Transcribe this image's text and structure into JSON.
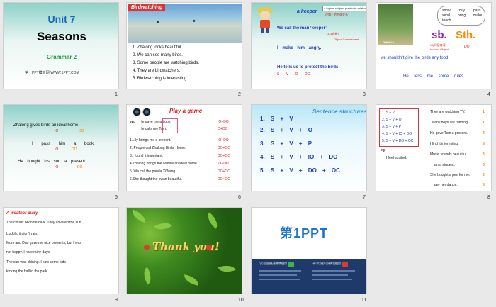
{
  "slides": [
    {
      "num": "1",
      "title": "Unit 7",
      "subtitle": "Seasons",
      "section": "Grammar 2",
      "footer": "第一PPT模板网-WWW.1PPT.COM"
    },
    {
      "num": "2",
      "banner": "Birdwatching",
      "lines": [
        "1. Zhalong looks beautiful.",
        "2. We can see many birds.",
        "3. Some people are watching birds.",
        "4. They are birdwatchers.",
        "5. Birdwatching is interesting."
      ]
    },
    {
      "num": "3",
      "heading": "a keeper",
      "note1": "A logical subject-predicate relation",
      "note2": "逻辑上的主谓关系",
      "line1": "We call the man ‘keeper’.",
      "line2": "I make him angry.",
      "line3": "He tells us to protect the birds",
      "oc_note": "OC(宾补)",
      "oc_note2": "Object Complement",
      "tags1": "S V O",
      "tags2": "S V O OC",
      "tags3": "S V O OC"
    },
    {
      "num": "4",
      "bubble": [
        "show",
        "send",
        "buy",
        "pass",
        "teach",
        "bring",
        "make"
      ],
      "big1": "sb.",
      "big2": "Sth.",
      "label1": "IO(间接宾语)",
      "label1b": "Indirect Object",
      "do_label": "DO",
      "label2": "XINHUA",
      "line1": "we shouldn’t give the birds any food.",
      "line2": "He tells me some rules."
    },
    {
      "num": "5",
      "lines": [
        "Zhalong gives birds an ideal home",
        "I pass him a book.",
        "He bought his son a present."
      ],
      "tags": [
        "IO",
        "DO"
      ]
    },
    {
      "num": "6",
      "banner": "Play a game",
      "eg": "eg:",
      "eg1": "He gave me a book.",
      "eg2": "He calls me Tom.",
      "eg1tag": "IO+DO",
      "eg2tag": "O+OC",
      "items": [
        {
          "text": "1.Lily brings me a present.",
          "tag": "IO+DO"
        },
        {
          "text": "2. People call Zhalong Birds’ Home.",
          "tag": "DO+OC"
        },
        {
          "text": "3.I found it important.",
          "tag": "DO+OC"
        },
        {
          "text": "4.Zhalong brings the wildlife an ideal home.",
          "tag": "IO+DO"
        },
        {
          "text": "5. We call the panda XiWang.",
          "tag": "DO+OC"
        },
        {
          "text": "6.She thought the swan beautiful.",
          "tag": "DO+OC"
        }
      ]
    },
    {
      "num": "7",
      "banner": "Sentence structures",
      "rows": [
        "1. S + V",
        "2. S + V + O",
        "3. S + V + P",
        "4. S + V + IO + DO",
        "5. S + V + DO + OC"
      ]
    },
    {
      "num": "8",
      "box": [
        "1. S + V",
        "2. S + V + O",
        "3. S + V + P",
        "4. S + V + IO + DO",
        "5. S + V + DO + OC"
      ],
      "eg": "eg:",
      "eg_line": "I feel excited.",
      "right": [
        "They are watching TV.",
        "Many boys are running.",
        "He gave Tom a present.",
        "I find it interesting.",
        "Music sounds beautiful.",
        "I am a student.",
        "She bought a pen for me.",
        "I saw her dance."
      ],
      "nums": [
        "1",
        "1",
        "4",
        "5",
        "3",
        "3",
        "2",
        "5"
      ]
    },
    {
      "num": "9",
      "title": "A weather diary",
      "lines": [
        "The clouds become dark. They covered the sun.",
        "Luckily, it didn’t rain.",
        "Mum and Dad gave me nice presents, but I was",
        "not happy. I hate rainy days.",
        "The sun was shining. I saw some kids",
        "kicking the ball in the park."
      ]
    },
    {
      "num": "10",
      "text": "Thank you!"
    },
    {
      "num": "11",
      "logo": "第1PPT",
      "col1_title": "可以自由任意编辑使用",
      "col2_title": "不可以在以下情况使用"
    }
  ],
  "colors": {
    "teal": "#8dd1c8",
    "red": "#d81b1b",
    "blue": "#1e3fb6",
    "orange": "#ff7a00",
    "purple": "#6a2c8f"
  }
}
